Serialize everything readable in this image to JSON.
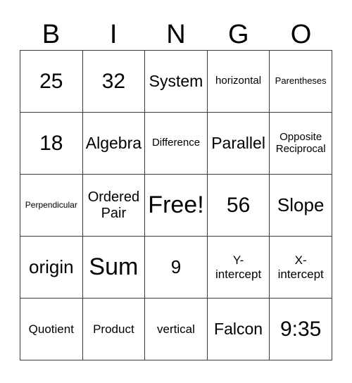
{
  "card": {
    "title_letters": [
      "B",
      "I",
      "N",
      "G",
      "O"
    ],
    "rows": [
      [
        {
          "text": "25",
          "size": "fs-xl"
        },
        {
          "text": "32",
          "size": "fs-xl"
        },
        {
          "text": "System",
          "size": "fs-md"
        },
        {
          "text": "horizontal",
          "size": "fs-xxs"
        },
        {
          "text": "Parentheses",
          "size": "fs-3xs"
        }
      ],
      [
        {
          "text": "18",
          "size": "fs-xl"
        },
        {
          "text": "Algebra",
          "size": "fs-md"
        },
        {
          "text": "Difference",
          "size": "fs-xxs"
        },
        {
          "text": "Parallel",
          "size": "fs-md"
        },
        {
          "text": "Opposite\nReciprocal",
          "size": "fs-xxs"
        }
      ],
      [
        {
          "text": "Perpendicular",
          "size": "fs-4xs"
        },
        {
          "text": "Ordered\nPair",
          "size": "fs-sm"
        },
        {
          "text": "Free!",
          "size": "fs-xxl"
        },
        {
          "text": "56",
          "size": "fs-xl"
        },
        {
          "text": "Slope",
          "size": "fs-lg"
        }
      ],
      [
        {
          "text": "origin",
          "size": "fs-lg"
        },
        {
          "text": "Sum",
          "size": "fs-xxl"
        },
        {
          "text": "9",
          "size": "fs-lg"
        },
        {
          "text": "Y-\nintercept",
          "size": "fs-xs"
        },
        {
          "text": "X-\nintercept",
          "size": "fs-xs"
        }
      ],
      [
        {
          "text": "Quotient",
          "size": "fs-xs"
        },
        {
          "text": "Product",
          "size": "fs-xs"
        },
        {
          "text": "vertical",
          "size": "fs-xs"
        },
        {
          "text": "Falcon",
          "size": "fs-md"
        },
        {
          "text": "9:35",
          "size": "fs-xl"
        }
      ]
    ]
  },
  "colors": {
    "text": "#000000",
    "grid_line": "#3a3a3a",
    "background": "#ffffff"
  }
}
